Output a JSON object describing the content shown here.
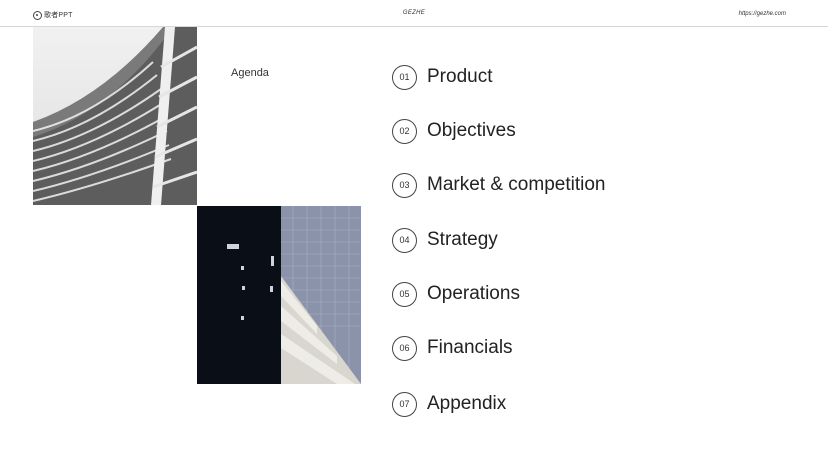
{
  "header": {
    "brand": "歌者PPT",
    "title": "GEZHE",
    "url": "https://gezhe.com"
  },
  "main": {
    "agenda_label": "Agenda",
    "items": [
      {
        "num": "01",
        "label": "Product"
      },
      {
        "num": "02",
        "label": "Objectives"
      },
      {
        "num": "03",
        "label": "Market & competition"
      },
      {
        "num": "04",
        "label": "Strategy"
      },
      {
        "num": "05",
        "label": "Operations"
      },
      {
        "num": "06",
        "label": "Financials"
      },
      {
        "num": "07",
        "label": "Appendix"
      }
    ]
  }
}
